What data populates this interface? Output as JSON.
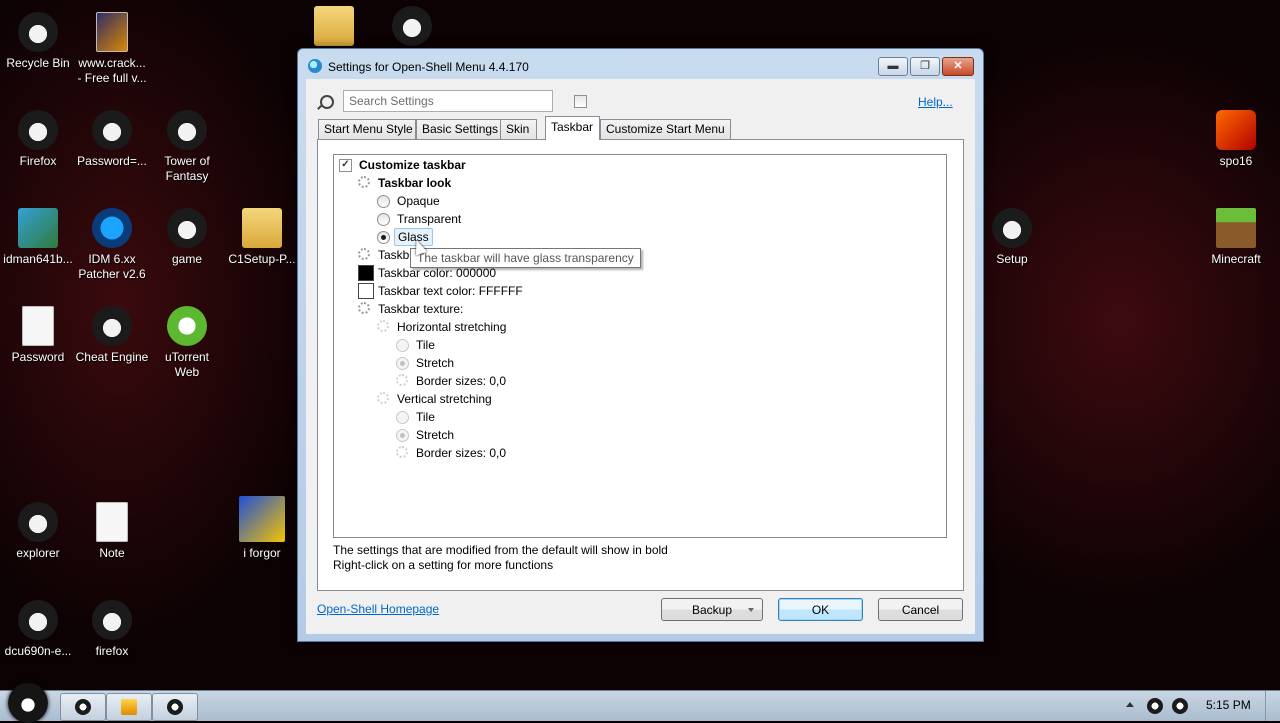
{
  "desktop": {
    "icons": [
      {
        "label": "Recycle Bin",
        "icon": "recycle-bin-icon"
      },
      {
        "label": "www.crack...\n- Free full v...",
        "icon": "video-file-icon"
      },
      {
        "label": "",
        "icon": "folder-icon"
      },
      {
        "label": "",
        "icon": "app-icon"
      },
      {
        "label": "Firefox",
        "icon": "firefox-icon"
      },
      {
        "label": "Password=...",
        "icon": "shortcut-icon"
      },
      {
        "label": "Tower of\nFantasy",
        "icon": "game-icon"
      },
      {
        "label": "idman641b...",
        "icon": "installer-icon"
      },
      {
        "label": "IDM 6.xx\nPatcher v2.6",
        "icon": "idm-icon"
      },
      {
        "label": "game",
        "icon": "shortcut-icon"
      },
      {
        "label": "C1Setup-P...",
        "icon": "folder-icon"
      },
      {
        "label": "Password",
        "icon": "text-file-icon"
      },
      {
        "label": "Cheat Engine",
        "icon": "cheat-engine-icon"
      },
      {
        "label": "uTorrent\nWeb",
        "icon": "utorrent-icon"
      },
      {
        "label": "explorer",
        "icon": "shortcut-icon"
      },
      {
        "label": "Note",
        "icon": "text-file-icon"
      },
      {
        "label": "i forgor",
        "icon": "image-icon"
      },
      {
        "label": "dcu690n-e...",
        "icon": "shortcut-icon"
      },
      {
        "label": "firefox",
        "icon": "shortcut-icon"
      },
      {
        "label": "spo16",
        "icon": "spo16-icon"
      },
      {
        "label": "Setup",
        "icon": "setup-icon"
      },
      {
        "label": "Minecraft",
        "icon": "minecraft-icon"
      }
    ]
  },
  "dialog": {
    "title": "Settings for Open-Shell Menu 4.4.170",
    "search_placeholder": "Search Settings",
    "help_label": "Help...",
    "tabs": [
      {
        "label": "Start Menu Style"
      },
      {
        "label": "Basic Settings"
      },
      {
        "label": "Skin"
      },
      {
        "label": "Taskbar"
      },
      {
        "label": "Customize Start Menu"
      }
    ],
    "active_tab": "Taskbar",
    "tree": {
      "customize_taskbar": "Customize taskbar",
      "taskbar_look": "Taskbar look",
      "opaque": "Opaque",
      "transparent": "Transparent",
      "glass": "Glass",
      "taskbar_opacity_partial": "Taskb",
      "taskbar_color": "Taskbar color: 000000",
      "taskbar_text_color": "Taskbar text color: FFFFFF",
      "taskbar_texture": "Taskbar texture:",
      "horizontal_stretching": "Horizontal stretching",
      "h_tile": "Tile",
      "h_stretch": "Stretch",
      "h_border": "Border sizes: 0,0",
      "vertical_stretching": "Vertical stretching",
      "v_tile": "Tile",
      "v_stretch": "Stretch",
      "v_border": "Border sizes: 0,0"
    },
    "colors": {
      "taskbar_color": "#000000",
      "taskbar_text_color": "#FFFFFF"
    },
    "tooltip": "The taskbar will have glass transparency",
    "info_line1": "The settings that are modified from the default will show in bold",
    "info_line2": "Right-click on a setting for more functions",
    "homepage_link": "Open-Shell Homepage",
    "backup_label": "Backup",
    "ok_label": "OK",
    "cancel_label": "Cancel"
  },
  "taskbar": {
    "clock": "5:15 PM"
  }
}
